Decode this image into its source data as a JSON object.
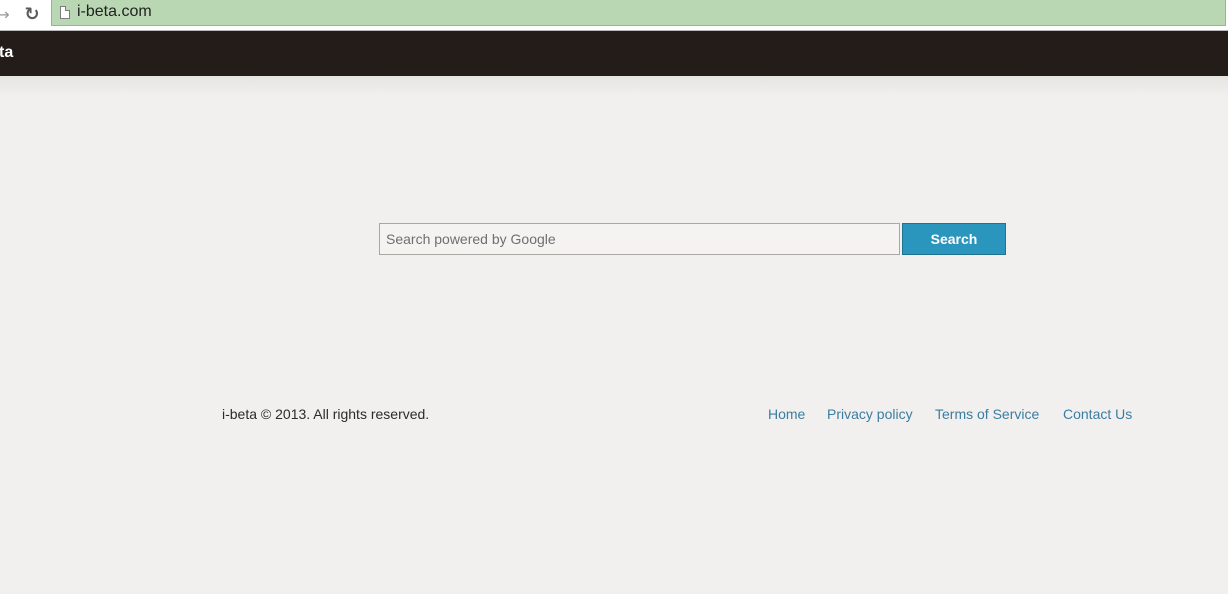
{
  "browser": {
    "url": "i-beta.com",
    "forward_icon": "forward-arrow-icon",
    "reload_icon": "reload-icon",
    "page_icon": "page-icon"
  },
  "header": {
    "brand": "ta",
    "background": "#231c18"
  },
  "search": {
    "placeholder": "Search powered by Google",
    "button_label": "Search",
    "button_color": "#2a95bd"
  },
  "footer": {
    "copyright": "i-beta © 2013. All rights reserved.",
    "links": [
      {
        "label": "Home"
      },
      {
        "label": "Privacy policy"
      },
      {
        "label": "Terms of Service"
      },
      {
        "label": "Contact Us"
      }
    ],
    "link_color": "#3b7da2"
  }
}
